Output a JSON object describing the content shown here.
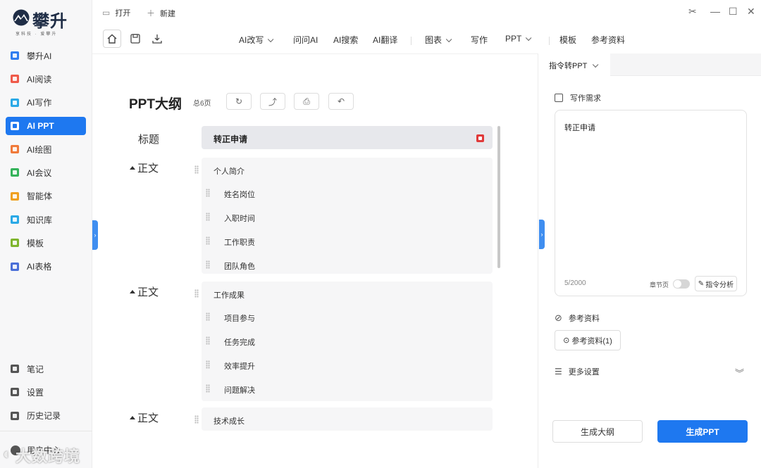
{
  "brand": {
    "name": "攀升",
    "tagline": "享科技 · 爱攀升"
  },
  "colors": {
    "accent": "#1e78f0",
    "sidebar_bg": "#f7f7f8",
    "title_row_bg": "#e7e8ec"
  },
  "sidebar": {
    "items": [
      {
        "label": "攀升AI",
        "icon": "panshen-ai-icon",
        "color": "#2f7df0"
      },
      {
        "label": "AI阅读",
        "icon": "reading-icon",
        "color": "#ef5a4a"
      },
      {
        "label": "AI写作",
        "icon": "writing-icon",
        "color": "#2aa9e6"
      },
      {
        "label": "AI PPT",
        "icon": "ppt-icon",
        "color": "#f0673a"
      },
      {
        "label": "AI绘图",
        "icon": "drawing-icon",
        "color": "#f07a3a"
      },
      {
        "label": "AI会议",
        "icon": "meeting-icon",
        "color": "#34b35a"
      },
      {
        "label": "智能体",
        "icon": "agent-icon",
        "color": "#f0a020"
      },
      {
        "label": "知识库",
        "icon": "knowledge-icon",
        "color": "#2aa9e6"
      },
      {
        "label": "模板",
        "icon": "template-icon",
        "color": "#7fb52e"
      },
      {
        "label": "AI表格",
        "icon": "table-icon",
        "color": "#4a6fd8"
      }
    ],
    "bottom": [
      {
        "label": "笔记",
        "icon": "notes-icon"
      },
      {
        "label": "设置",
        "icon": "settings-icon"
      },
      {
        "label": "历史记录",
        "icon": "history-icon"
      }
    ],
    "user_label": "用户中心",
    "watermark": "大数跨境"
  },
  "titlebar": {
    "open_label": "打开",
    "new_label": "新建"
  },
  "toolbar": {
    "menus": [
      {
        "label": "AI改写",
        "dropdown": true
      },
      {
        "label": "问问AI",
        "dropdown": false
      },
      {
        "label": "AI搜索",
        "dropdown": false
      },
      {
        "label": "AI翻译",
        "dropdown": false
      },
      {
        "label": "图表",
        "dropdown": true
      },
      {
        "label": "写作",
        "dropdown": false
      },
      {
        "label": "PPT",
        "dropdown": true
      },
      {
        "label": "模板",
        "dropdown": false
      },
      {
        "label": "参考资料",
        "dropdown": false
      }
    ]
  },
  "outline": {
    "title": "PPT大纲",
    "page_count": "总6页",
    "title_label": "标题",
    "title_value": "转正申请",
    "body_label": "正文",
    "sections": [
      {
        "heading": "个人简介",
        "items": [
          "姓名岗位",
          "入职时间",
          "工作职责",
          "团队角色"
        ]
      },
      {
        "heading": "工作成果",
        "items": [
          "项目参与",
          "任务完成",
          "效率提升",
          "问题解决"
        ]
      },
      {
        "heading": "技术成长",
        "items": []
      }
    ]
  },
  "right_panel": {
    "tab_label": "指令转PPT",
    "requirement_heading": "写作需求",
    "requirement_value": "转正申请",
    "char_count": "5/2000",
    "chapter_page_label": "章节页",
    "analyze_label": "指令分析",
    "reference_heading": "参考资料",
    "reference_button": "参考资料(1)",
    "more_settings": "更多设置",
    "gen_outline": "生成大纲",
    "gen_ppt": "生成PPT"
  }
}
